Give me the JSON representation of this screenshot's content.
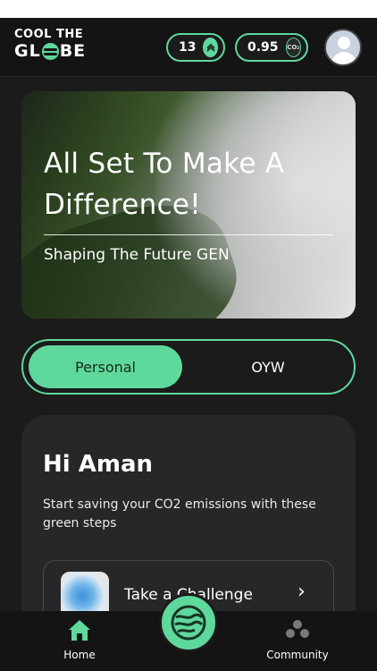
{
  "app": {
    "logo_line1": "COOL THE",
    "logo_line2_before": "GL",
    "logo_line2_after": "BE"
  },
  "header": {
    "points_value": "13",
    "co2_value": "0.95",
    "co2_icon_text": "CO₂"
  },
  "hero": {
    "title": "All Set To Make A Difference!",
    "subtitle": "Shaping The Future GEN"
  },
  "toggle": {
    "options": [
      "Personal",
      "OYW"
    ],
    "selected": "Personal"
  },
  "card": {
    "greeting": "Hi Aman",
    "description": "Start saving your CO2 emissions with these green steps",
    "challenge_label": "Take a Challenge"
  },
  "nav": {
    "home_label": "Home",
    "community_label": "Community"
  },
  "colors": {
    "accent": "#5fd89c",
    "background": "#1b1b1b",
    "header": "#141414",
    "card": "#272727"
  },
  "icons": [
    "coin-icon",
    "co2-cloud-icon",
    "avatar-icon",
    "chevron-right-icon",
    "home-icon",
    "community-icon",
    "globe-fab-icon"
  ]
}
